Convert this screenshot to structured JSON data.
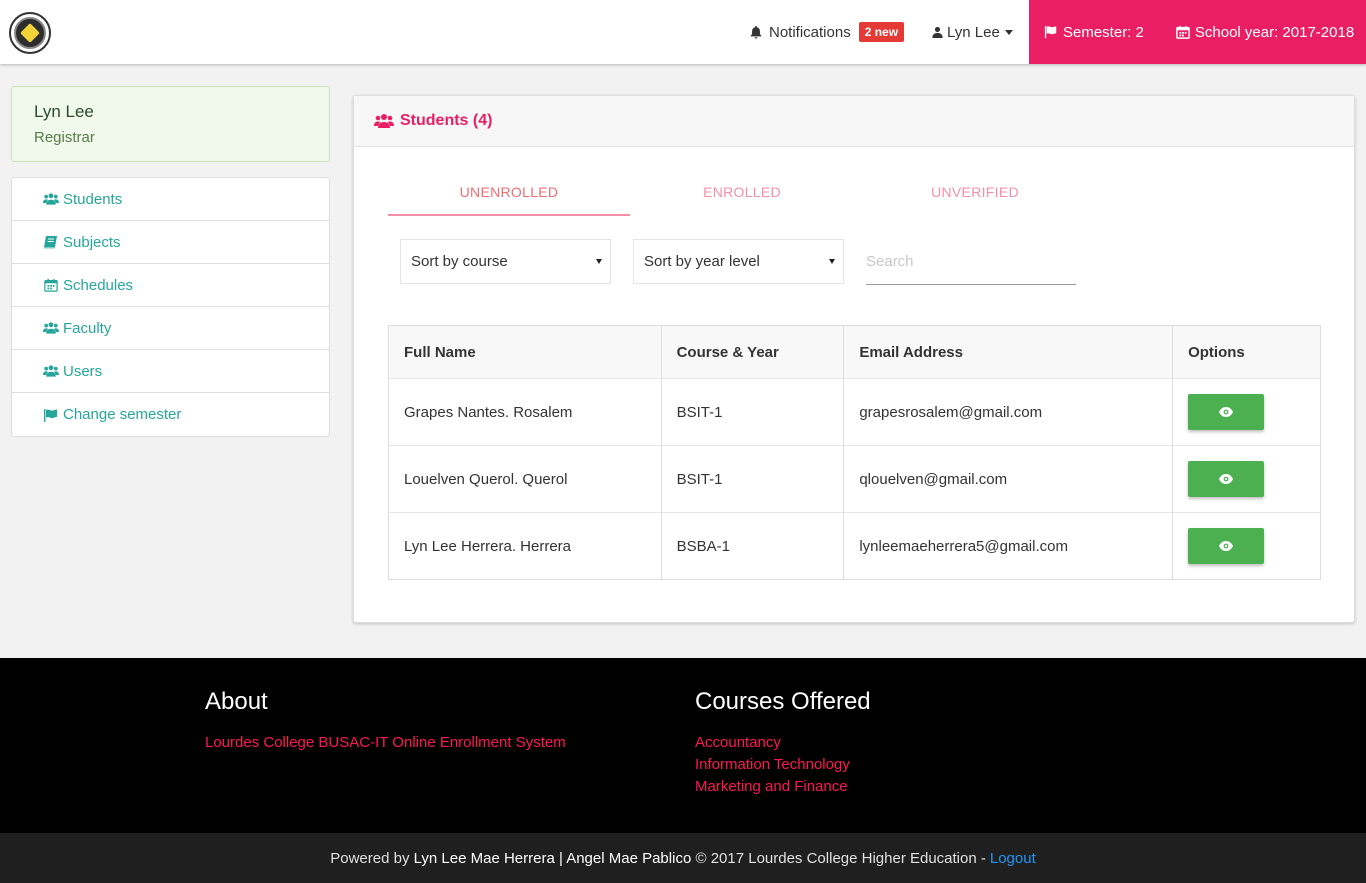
{
  "navbar": {
    "notifications_label": "Notifications",
    "notifications_badge": "2 new",
    "user_name": "Lyn Lee",
    "semester": "Semester: 2",
    "school_year": "School year: 2017-2018"
  },
  "sidebar": {
    "profile_name": "Lyn Lee",
    "profile_role": "Registrar",
    "items": [
      {
        "label": "Students",
        "icon": "users-icon"
      },
      {
        "label": "Subjects",
        "icon": "book-icon"
      },
      {
        "label": "Schedules",
        "icon": "calendar-icon"
      },
      {
        "label": "Faculty",
        "icon": "users-icon"
      },
      {
        "label": "Users",
        "icon": "users-icon"
      },
      {
        "label": "Change semester",
        "icon": "flag-icon"
      }
    ]
  },
  "main": {
    "title": "Students (4)",
    "tabs": [
      "UNENROLLED",
      "ENROLLED",
      "UNVERIFIED"
    ],
    "active_tab": "UNENROLLED",
    "sort_course": "Sort by course",
    "sort_year": "Sort by year level",
    "search_placeholder": "Search",
    "columns": [
      "Full Name",
      "Course & Year",
      "Email Address",
      "Options"
    ],
    "rows": [
      {
        "name": "Grapes Nantes. Rosalem",
        "course": "BSIT-1",
        "email": "grapesrosalem@gmail.com"
      },
      {
        "name": "Louelven Querol. Querol",
        "course": "BSIT-1",
        "email": "qlouelven@gmail.com"
      },
      {
        "name": "Lyn Lee Herrera. Herrera",
        "course": "BSBA-1",
        "email": "lynleemaeherrera5@gmail.com"
      }
    ]
  },
  "footer": {
    "about_title": "About",
    "about_link": "Lourdes College BUSAC-IT Online Enrollment System",
    "courses_title": "Courses Offered",
    "courses": [
      "Accountancy",
      "Information Technology",
      "Marketing and Finance"
    ],
    "powered_by": "Powered by",
    "authors": "Lyn Lee Mae Herrera | Angel Mae Pablico",
    "copyright": "© 2017 Lourdes College Higher Education -",
    "logout": "Logout"
  },
  "colors": {
    "accent": "#e91e63",
    "teal": "#26a69a",
    "success": "#4caf50",
    "link_red": "#ff1654",
    "link_blue": "#2196f3"
  }
}
